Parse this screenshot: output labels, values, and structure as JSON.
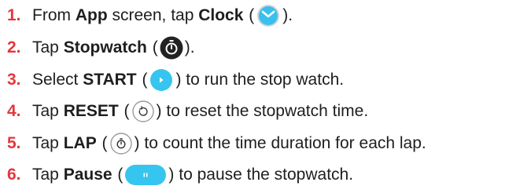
{
  "steps": [
    {
      "number": "1.",
      "parts": {
        "a": "From ",
        "b": "App",
        "c": " screen, tap ",
        "d": "Clock",
        "e": " (",
        "f": ")."
      },
      "icon": "clock-icon"
    },
    {
      "number": "2.",
      "parts": {
        "a": "Tap ",
        "b": "Stopwatch",
        "c": " (",
        "d": ")."
      },
      "icon": "stopwatch-icon"
    },
    {
      "number": "3.",
      "parts": {
        "a": "Select ",
        "b": "START",
        "c": " (",
        "d": ") to run the stop watch."
      },
      "icon": "start-play-icon"
    },
    {
      "number": "4.",
      "parts": {
        "a": "Tap ",
        "b": "RESET",
        "c": " (",
        "d": ") to reset the stopwatch time."
      },
      "icon": "reset-icon"
    },
    {
      "number": "5.",
      "parts": {
        "a": "Tap ",
        "b": "LAP",
        "c": " (",
        "d": ") to count the time duration for each lap."
      },
      "icon": "lap-icon"
    },
    {
      "number": "6.",
      "parts": {
        "a": "Tap ",
        "b": "Pause",
        "c": " (",
        "d": ") to pause the stopwatch."
      },
      "icon": "pause-icon"
    }
  ],
  "colors": {
    "number": "#e2373f",
    "text": "#1e1e1e",
    "accent_blue": "#36c5ef",
    "icon_dark": "#222222"
  }
}
